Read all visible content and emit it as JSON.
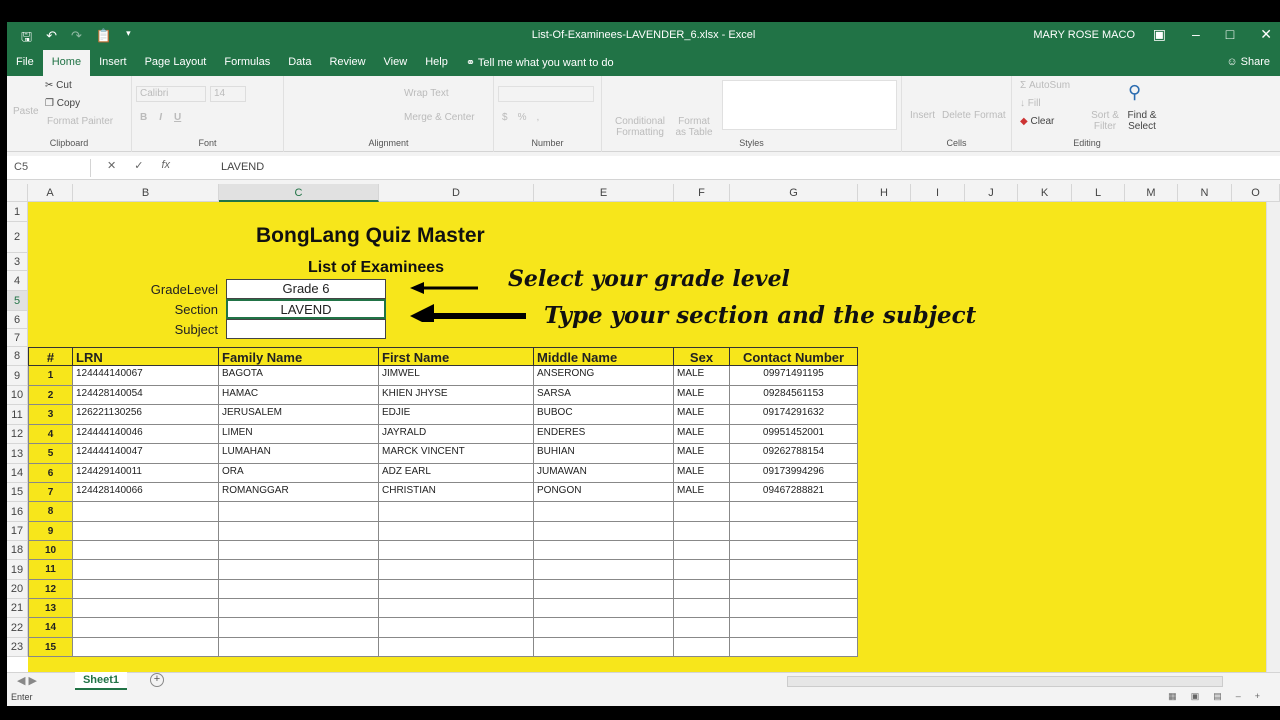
{
  "window": {
    "title": "List-Of-Examinees-LAVENDER_6.xlsx  -  Excel",
    "user": "MARY ROSE MACO"
  },
  "menu": {
    "tabs": [
      "File",
      "Home",
      "Insert",
      "Page Layout",
      "Formulas",
      "Data",
      "Review",
      "View",
      "Help"
    ],
    "tell_me": "Tell me what you want to do",
    "share": "Share"
  },
  "ribbon": {
    "clipboard": {
      "paste": "Paste",
      "cut": "Cut",
      "copy": "Copy",
      "format_painter": "Format Painter",
      "label": "Clipboard"
    },
    "font": {
      "name": "Calibri",
      "size": "14",
      "label": "Font"
    },
    "alignment": {
      "wrap": "Wrap Text",
      "merge": "Merge & Center",
      "label": "Alignment"
    },
    "number": {
      "label": "Number"
    },
    "styles": {
      "cond": "Conditional Formatting",
      "table": "Format as Table",
      "label": "Styles"
    },
    "cells": {
      "insert": "Insert",
      "delete": "Delete",
      "format": "Format",
      "label": "Cells"
    },
    "editing": {
      "autosum": "AutoSum",
      "fill": "Fill",
      "clear": "Clear",
      "sort": "Sort & Filter",
      "find": "Find & Select",
      "label": "Editing"
    }
  },
  "formula_bar": {
    "name_box": "C5",
    "value": "LAVEND"
  },
  "columns": [
    "A",
    "B",
    "C",
    "D",
    "E",
    "F",
    "G",
    "H",
    "I",
    "J",
    "K",
    "L",
    "M",
    "N",
    "O"
  ],
  "rows": [
    "1",
    "2",
    "3",
    "4",
    "5",
    "6",
    "7",
    "8",
    "9",
    "10",
    "11",
    "12",
    "13",
    "14",
    "15",
    "16",
    "17",
    "18",
    "19",
    "20",
    "21",
    "22",
    "23"
  ],
  "sheet": {
    "title": "BongLang Quiz Master",
    "subtitle": "List of Examinees",
    "form": [
      {
        "label": "GradeLevel",
        "value": "Grade 6"
      },
      {
        "label": "Section",
        "value": "LAVEND"
      },
      {
        "label": "Subject",
        "value": ""
      }
    ],
    "note1": "Select your grade level",
    "note2": "Type your section and the subject",
    "headers": [
      "#",
      "LRN",
      "Family Name",
      "First Name",
      "Middle Name",
      "Sex",
      "Contact Number"
    ],
    "students": [
      [
        "1",
        "124444140067",
        "BAGOTA",
        "JIMWEL",
        "ANSERONG",
        "MALE",
        "09971491195"
      ],
      [
        "2",
        "124428140054",
        "HAMAC",
        "KHIEN JHYSE",
        "SARSA",
        "MALE",
        "09284561153"
      ],
      [
        "3",
        "126221130256",
        "JERUSALEM",
        "EDJIE",
        "BUBOC",
        "MALE",
        "09174291632"
      ],
      [
        "4",
        "124444140046",
        "LIMEN",
        "JAYRALD",
        "ENDERES",
        "MALE",
        "09951452001"
      ],
      [
        "5",
        "124444140047",
        "LUMAHAN",
        "MARCK VINCENT",
        "BUHIAN",
        "MALE",
        "09262788154"
      ],
      [
        "6",
        "124429140011",
        "ORA",
        "ADZ EARL",
        "JUMAWAN",
        "MALE",
        "09173994296"
      ],
      [
        "7",
        "124428140066",
        "ROMANGGAR",
        "CHRISTIAN",
        "PONGON",
        "MALE",
        "09467288821"
      ],
      [
        "8",
        "",
        "",
        "",
        "",
        "",
        ""
      ],
      [
        "9",
        "",
        "",
        "",
        "",
        "",
        ""
      ],
      [
        "10",
        "",
        "",
        "",
        "",
        "",
        ""
      ],
      [
        "11",
        "",
        "",
        "",
        "",
        "",
        ""
      ],
      [
        "12",
        "",
        "",
        "",
        "",
        "",
        ""
      ],
      [
        "13",
        "",
        "",
        "",
        "",
        "",
        ""
      ],
      [
        "14",
        "",
        "",
        "",
        "",
        "",
        ""
      ],
      [
        "15",
        "",
        "",
        "",
        "",
        "",
        ""
      ]
    ]
  },
  "sheet_tab": "Sheet1",
  "status": "Enter"
}
